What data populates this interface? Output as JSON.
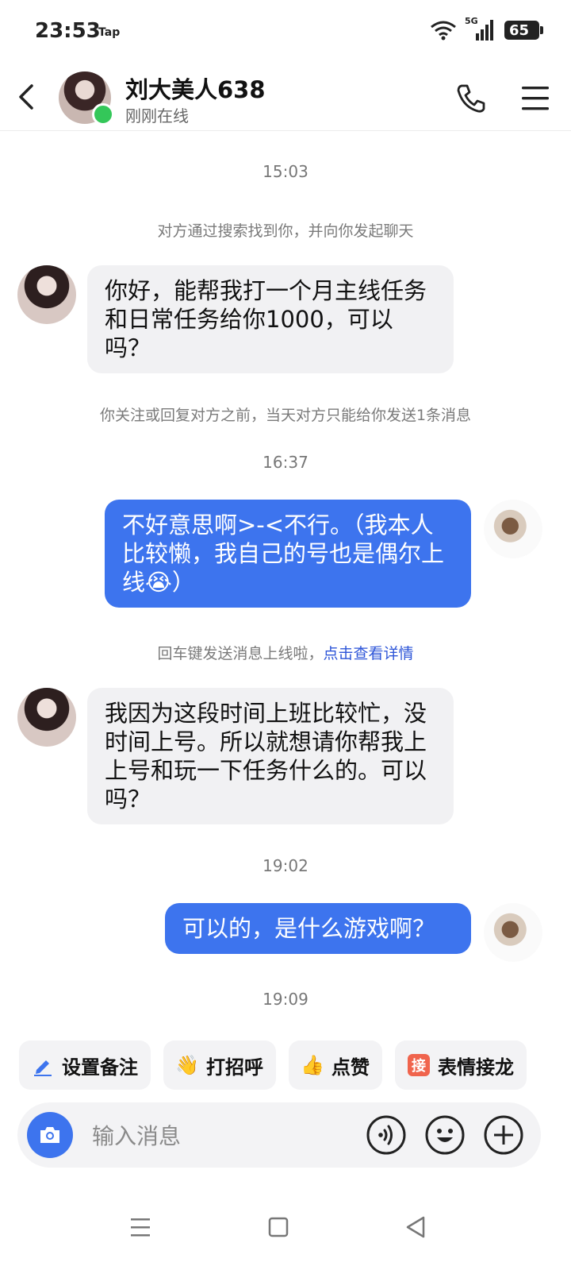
{
  "status_bar": {
    "time": "23:53",
    "app_tag": "Tap",
    "network": "5G",
    "battery": "65"
  },
  "header": {
    "contact_name": "刘大美人638",
    "contact_status": "刚刚在线"
  },
  "chat": {
    "time_1": "15:03",
    "note_1": "对方通过搜索找到你，并向你发起聊天",
    "msg_1": "你好，能帮我打一个月主线任务和日常任务给你1000，可以吗？",
    "note_2": "你关注或回复对方之前，当天对方只能给你发送1条消息",
    "time_2": "16:37",
    "msg_2": "不好意思啊>-<不行。（我本人比较懒，我自己的号也是偶尔上线😭）",
    "note_3": "回车键发送消息上线啦，",
    "note_3_link": "点击查看详情",
    "msg_3": "我因为这段时间上班比较忙，没时间上号。所以就想请你帮我上上号和玩一下任务什么的。可以吗？",
    "time_3": "19:02",
    "msg_4": "可以的，是什么游戏啊？",
    "time_4": "19:09"
  },
  "quick_actions": {
    "set_note": "设置备注",
    "greet": "打招呼",
    "like": "点赞",
    "emoji_chain_badge": "接",
    "emoji_chain": "表情接龙"
  },
  "composer": {
    "placeholder": "输入消息"
  },
  "colors": {
    "accent": "#3d74ee",
    "online": "#34c759",
    "bubble_left": "#f1f1f3"
  }
}
